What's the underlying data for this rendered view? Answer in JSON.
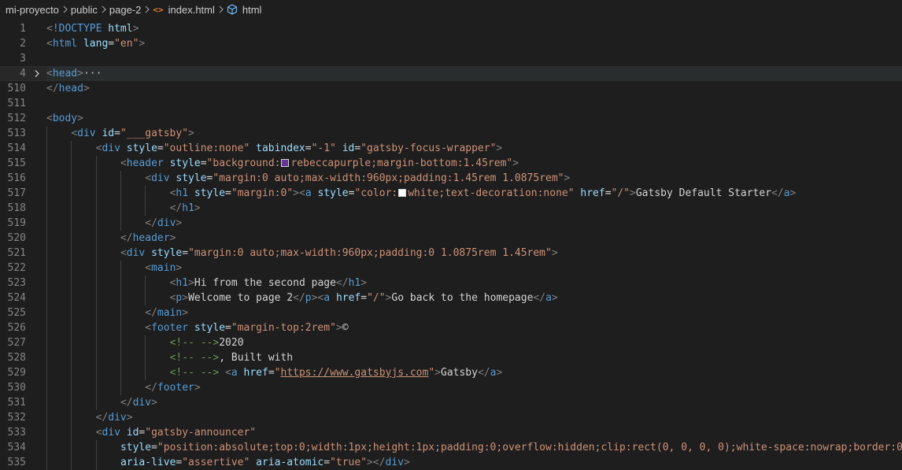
{
  "breadcrumb": {
    "items": [
      "mi-proyecto",
      "public",
      "page-2",
      "index.html",
      "html"
    ],
    "file_icon": "html-file-icon",
    "symbol_icon": "symbol-cube-icon"
  },
  "colors": {
    "tag": "#569cd6",
    "punct": "#808080",
    "attr": "#9cdcfe",
    "string": "#ce9178",
    "text": "#d4d4d4",
    "comment": "#6a9955",
    "rebeccapurple": "#663399",
    "white": "#ffffff"
  },
  "editor": {
    "current_line": "4",
    "lines": [
      {
        "n": "1",
        "indent": 0,
        "tokens": [
          [
            "p",
            "<"
          ],
          [
            "t",
            "!DOCTYPE"
          ],
          [
            "x",
            " "
          ],
          [
            "a",
            "html"
          ],
          [
            "p",
            ">"
          ]
        ]
      },
      {
        "n": "2",
        "indent": 0,
        "tokens": [
          [
            "p",
            "<"
          ],
          [
            "t",
            "html"
          ],
          [
            "x",
            " "
          ],
          [
            "a",
            "lang"
          ],
          [
            "x",
            "="
          ],
          [
            "s",
            "\"en\""
          ],
          [
            "p",
            ">"
          ]
        ]
      },
      {
        "n": "3",
        "indent": 0,
        "tokens": []
      },
      {
        "n": "4",
        "indent": 0,
        "fold": true,
        "tokens": [
          [
            "p",
            "<"
          ],
          [
            "t",
            "head"
          ],
          [
            "p",
            ">"
          ],
          [
            "e",
            "···"
          ]
        ]
      },
      {
        "n": "510",
        "indent": 0,
        "tokens": [
          [
            "p",
            "</"
          ],
          [
            "t",
            "head"
          ],
          [
            "p",
            ">"
          ]
        ]
      },
      {
        "n": "511",
        "indent": 0,
        "tokens": []
      },
      {
        "n": "512",
        "indent": 0,
        "tokens": [
          [
            "p",
            "<"
          ],
          [
            "t",
            "body"
          ],
          [
            "p",
            ">"
          ]
        ]
      },
      {
        "n": "513",
        "indent": 1,
        "tokens": [
          [
            "p",
            "<"
          ],
          [
            "t",
            "div"
          ],
          [
            "x",
            " "
          ],
          [
            "a",
            "id"
          ],
          [
            "x",
            "="
          ],
          [
            "s",
            "\"___gatsby\""
          ],
          [
            "p",
            ">"
          ]
        ]
      },
      {
        "n": "514",
        "indent": 2,
        "tokens": [
          [
            "p",
            "<"
          ],
          [
            "t",
            "div"
          ],
          [
            "x",
            " "
          ],
          [
            "a",
            "style"
          ],
          [
            "x",
            "="
          ],
          [
            "s",
            "\"outline:none\""
          ],
          [
            "x",
            " "
          ],
          [
            "a",
            "tabindex"
          ],
          [
            "x",
            "="
          ],
          [
            "s",
            "\"-1\""
          ],
          [
            "x",
            " "
          ],
          [
            "a",
            "id"
          ],
          [
            "x",
            "="
          ],
          [
            "s",
            "\"gatsby-focus-wrapper\""
          ],
          [
            "p",
            ">"
          ]
        ]
      },
      {
        "n": "515",
        "indent": 3,
        "tokens": [
          [
            "p",
            "<"
          ],
          [
            "t",
            "header"
          ],
          [
            "x",
            " "
          ],
          [
            "a",
            "style"
          ],
          [
            "x",
            "="
          ],
          [
            "s",
            "\"background:"
          ],
          [
            "sw",
            "rebeccapurple"
          ],
          [
            "s",
            "rebeccapurple;margin-bottom:1.45rem\""
          ],
          [
            "p",
            ">"
          ]
        ]
      },
      {
        "n": "516",
        "indent": 4,
        "tokens": [
          [
            "p",
            "<"
          ],
          [
            "t",
            "div"
          ],
          [
            "x",
            " "
          ],
          [
            "a",
            "style"
          ],
          [
            "x",
            "="
          ],
          [
            "s",
            "\"margin:0 auto;max-width:960px;padding:1.45rem 1.0875rem\""
          ],
          [
            "p",
            ">"
          ]
        ]
      },
      {
        "n": "517",
        "indent": 5,
        "tokens": [
          [
            "p",
            "<"
          ],
          [
            "t",
            "h1"
          ],
          [
            "x",
            " "
          ],
          [
            "a",
            "style"
          ],
          [
            "x",
            "="
          ],
          [
            "s",
            "\"margin:0\""
          ],
          [
            "p",
            ">"
          ],
          [
            "p",
            "<"
          ],
          [
            "t",
            "a"
          ],
          [
            "x",
            " "
          ],
          [
            "a",
            "style"
          ],
          [
            "x",
            "="
          ],
          [
            "s",
            "\"color:"
          ],
          [
            "sw",
            "white"
          ],
          [
            "s",
            "white;text-decoration:none\""
          ],
          [
            "x",
            " "
          ],
          [
            "a",
            "href"
          ],
          [
            "x",
            "="
          ],
          [
            "s",
            "\"/\""
          ],
          [
            "p",
            ">"
          ],
          [
            "x",
            "Gatsby Default Starter"
          ],
          [
            "p",
            "</"
          ],
          [
            "t",
            "a"
          ],
          [
            "p",
            ">"
          ]
        ]
      },
      {
        "n": "518",
        "indent": 5,
        "tokens": [
          [
            "p",
            "</"
          ],
          [
            "t",
            "h1"
          ],
          [
            "p",
            ">"
          ]
        ]
      },
      {
        "n": "519",
        "indent": 4,
        "tokens": [
          [
            "p",
            "</"
          ],
          [
            "t",
            "div"
          ],
          [
            "p",
            ">"
          ]
        ]
      },
      {
        "n": "520",
        "indent": 3,
        "tokens": [
          [
            "p",
            "</"
          ],
          [
            "t",
            "header"
          ],
          [
            "p",
            ">"
          ]
        ]
      },
      {
        "n": "521",
        "indent": 3,
        "tokens": [
          [
            "p",
            "<"
          ],
          [
            "t",
            "div"
          ],
          [
            "x",
            " "
          ],
          [
            "a",
            "style"
          ],
          [
            "x",
            "="
          ],
          [
            "s",
            "\"margin:0 auto;max-width:960px;padding:0 1.0875rem 1.45rem\""
          ],
          [
            "p",
            ">"
          ]
        ]
      },
      {
        "n": "522",
        "indent": 4,
        "tokens": [
          [
            "p",
            "<"
          ],
          [
            "t",
            "main"
          ],
          [
            "p",
            ">"
          ]
        ]
      },
      {
        "n": "523",
        "indent": 5,
        "tokens": [
          [
            "p",
            "<"
          ],
          [
            "t",
            "h1"
          ],
          [
            "p",
            ">"
          ],
          [
            "x",
            "Hi from the second page"
          ],
          [
            "p",
            "</"
          ],
          [
            "t",
            "h1"
          ],
          [
            "p",
            ">"
          ]
        ]
      },
      {
        "n": "524",
        "indent": 5,
        "tokens": [
          [
            "p",
            "<"
          ],
          [
            "t",
            "p"
          ],
          [
            "p",
            ">"
          ],
          [
            "x",
            "Welcome to page 2"
          ],
          [
            "p",
            "</"
          ],
          [
            "t",
            "p"
          ],
          [
            "p",
            ">"
          ],
          [
            "p",
            "<"
          ],
          [
            "t",
            "a"
          ],
          [
            "x",
            " "
          ],
          [
            "a",
            "href"
          ],
          [
            "x",
            "="
          ],
          [
            "s",
            "\"/\""
          ],
          [
            "p",
            ">"
          ],
          [
            "x",
            "Go back to the homepage"
          ],
          [
            "p",
            "</"
          ],
          [
            "t",
            "a"
          ],
          [
            "p",
            ">"
          ]
        ]
      },
      {
        "n": "525",
        "indent": 4,
        "tokens": [
          [
            "p",
            "</"
          ],
          [
            "t",
            "main"
          ],
          [
            "p",
            ">"
          ]
        ]
      },
      {
        "n": "526",
        "indent": 4,
        "tokens": [
          [
            "p",
            "<"
          ],
          [
            "t",
            "footer"
          ],
          [
            "x",
            " "
          ],
          [
            "a",
            "style"
          ],
          [
            "x",
            "="
          ],
          [
            "s",
            "\"margin-top:2rem\""
          ],
          [
            "p",
            ">"
          ],
          [
            "x",
            "©"
          ]
        ]
      },
      {
        "n": "527",
        "indent": 5,
        "tokens": [
          [
            "c",
            "<!-- -->"
          ],
          [
            "x",
            "2020"
          ]
        ]
      },
      {
        "n": "528",
        "indent": 5,
        "tokens": [
          [
            "c",
            "<!-- -->"
          ],
          [
            "x",
            ", Built with"
          ]
        ]
      },
      {
        "n": "529",
        "indent": 5,
        "tokens": [
          [
            "c",
            "<!-- -->"
          ],
          [
            "x",
            " "
          ],
          [
            "p",
            "<"
          ],
          [
            "t",
            "a"
          ],
          [
            "x",
            " "
          ],
          [
            "a",
            "href"
          ],
          [
            "x",
            "="
          ],
          [
            "s",
            "\""
          ],
          [
            "l",
            "https://www.gatsbyjs.com"
          ],
          [
            "s",
            "\""
          ],
          [
            "p",
            ">"
          ],
          [
            "x",
            "Gatsby"
          ],
          [
            "p",
            "</"
          ],
          [
            "t",
            "a"
          ],
          [
            "p",
            ">"
          ]
        ]
      },
      {
        "n": "530",
        "indent": 4,
        "tokens": [
          [
            "p",
            "</"
          ],
          [
            "t",
            "footer"
          ],
          [
            "p",
            ">"
          ]
        ]
      },
      {
        "n": "531",
        "indent": 3,
        "tokens": [
          [
            "p",
            "</"
          ],
          [
            "t",
            "div"
          ],
          [
            "p",
            ">"
          ]
        ]
      },
      {
        "n": "532",
        "indent": 2,
        "tokens": [
          [
            "p",
            "</"
          ],
          [
            "t",
            "div"
          ],
          [
            "p",
            ">"
          ]
        ]
      },
      {
        "n": "533",
        "indent": 2,
        "tokens": [
          [
            "p",
            "<"
          ],
          [
            "t",
            "div"
          ],
          [
            "x",
            " "
          ],
          [
            "a",
            "id"
          ],
          [
            "x",
            "="
          ],
          [
            "s",
            "\"gatsby-announcer\""
          ]
        ]
      },
      {
        "n": "534",
        "indent": 3,
        "tokens": [
          [
            "a",
            "style"
          ],
          [
            "x",
            "="
          ],
          [
            "s",
            "\"position:absolute;top:0;width:1px;height:1px;padding:0;overflow:hidden;clip:rect(0, 0, 0, 0);white-space:nowrap;border:0\""
          ]
        ]
      },
      {
        "n": "535",
        "indent": 3,
        "tokens": [
          [
            "a",
            "aria-live"
          ],
          [
            "x",
            "="
          ],
          [
            "s",
            "\"assertive\""
          ],
          [
            "x",
            " "
          ],
          [
            "a",
            "aria-atomic"
          ],
          [
            "x",
            "="
          ],
          [
            "s",
            "\"true\""
          ],
          [
            "p",
            ">"
          ],
          [
            "p",
            "</"
          ],
          [
            "t",
            "div"
          ],
          [
            "p",
            ">"
          ]
        ]
      }
    ]
  }
}
